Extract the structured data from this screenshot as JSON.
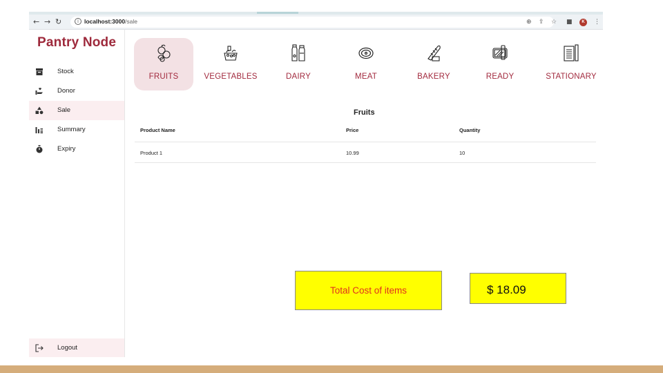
{
  "browser": {
    "url_host": "localhost:3000",
    "url_path": "/sale",
    "profile_initial": "K"
  },
  "app": {
    "title": "Pantry Node"
  },
  "sidebar": {
    "items": [
      {
        "label": "Stock",
        "icon": "archive-icon"
      },
      {
        "label": "Donor",
        "icon": "hand-heart-icon"
      },
      {
        "label": "Sale",
        "icon": "shapes-icon",
        "active": true
      },
      {
        "label": "Summary",
        "icon": "bar-chart-icon"
      },
      {
        "label": "Expiry",
        "icon": "timer-icon"
      }
    ],
    "logout_label": "Logout"
  },
  "categories": [
    {
      "label": "FRUITS",
      "icon": "fruits-icon",
      "active": true
    },
    {
      "label": "VEGETABLES",
      "icon": "vegetables-icon"
    },
    {
      "label": "DAIRY",
      "icon": "dairy-icon"
    },
    {
      "label": "MEAT",
      "icon": "meat-icon"
    },
    {
      "label": "BAKERY",
      "icon": "bakery-icon"
    },
    {
      "label": "READY",
      "icon": "ready-meal-icon"
    },
    {
      "label": "STATIONARY",
      "icon": "stationary-icon"
    }
  ],
  "section_title": "Fruits",
  "table": {
    "columns": [
      "Product Name",
      "Price",
      "Quantity"
    ],
    "rows": [
      [
        "Product 1",
        "10.99",
        "10"
      ]
    ]
  },
  "totals": {
    "label": "Total Cost of items",
    "value": "$ 18.09"
  },
  "colors": {
    "brand": "#9e2a3c",
    "active_bg": "#fbeef0",
    "highlight": "#ffff00",
    "total_label": "#e0301e",
    "bottom_bar": "#d5ad7b"
  }
}
